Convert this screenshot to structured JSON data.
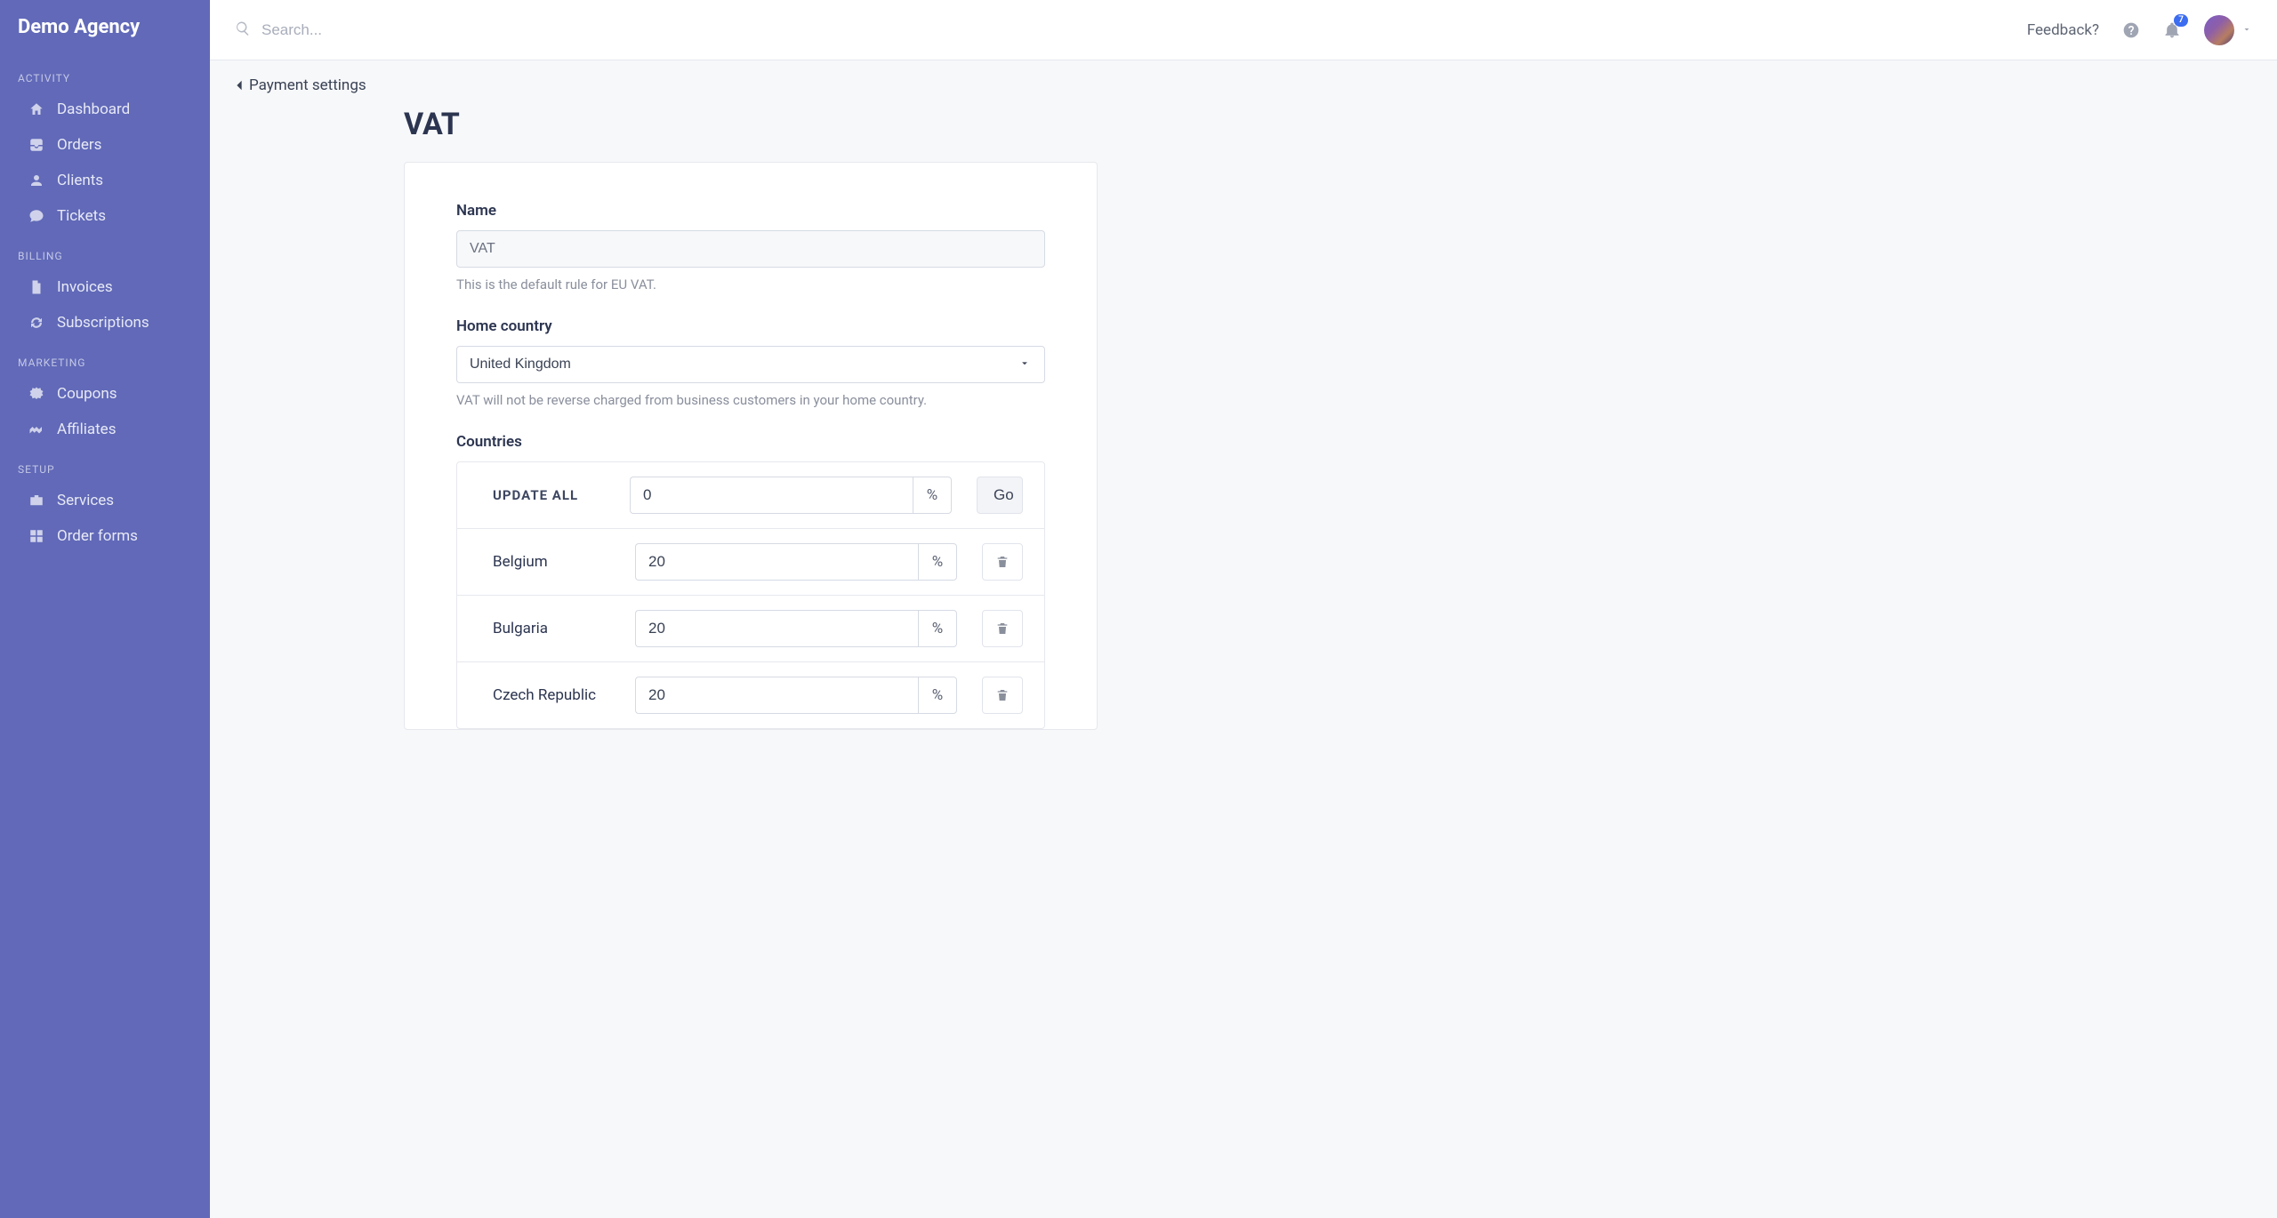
{
  "brand": "Demo Agency",
  "topbar": {
    "search_placeholder": "Search...",
    "feedback_label": "Feedback?",
    "notification_count": "7"
  },
  "sidebar": {
    "sections": [
      {
        "title": "ACTIVITY",
        "items": [
          {
            "label": "Dashboard",
            "icon": "home-icon"
          },
          {
            "label": "Orders",
            "icon": "inbox-in-icon"
          },
          {
            "label": "Clients",
            "icon": "user-icon"
          },
          {
            "label": "Tickets",
            "icon": "comment-icon"
          }
        ]
      },
      {
        "title": "BILLING",
        "items": [
          {
            "label": "Invoices",
            "icon": "file-icon"
          },
          {
            "label": "Subscriptions",
            "icon": "sync-icon"
          }
        ]
      },
      {
        "title": "MARKETING",
        "items": [
          {
            "label": "Coupons",
            "icon": "badge-icon"
          },
          {
            "label": "Affiliates",
            "icon": "handshake-icon"
          }
        ]
      },
      {
        "title": "SETUP",
        "items": [
          {
            "label": "Services",
            "icon": "briefcase-icon"
          },
          {
            "label": "Order forms",
            "icon": "grid-icon"
          }
        ]
      }
    ]
  },
  "breadcrumb": {
    "back_label": "Payment settings"
  },
  "page": {
    "title": "VAT",
    "name_label": "Name",
    "name_value": "VAT",
    "name_helper": "This is the default rule for EU VAT.",
    "home_country_label": "Home country",
    "home_country_value": "United Kingdom",
    "home_country_helper": "VAT will not be reverse charged from business customers in your home country.",
    "countries_label": "Countries",
    "update_all_label": "UPDATE ALL",
    "update_all_value": "0",
    "percent_symbol": "%",
    "go_label": "Go",
    "rows": [
      {
        "country": "Belgium",
        "rate": "20"
      },
      {
        "country": "Bulgaria",
        "rate": "20"
      },
      {
        "country": "Czech Republic",
        "rate": "20"
      }
    ]
  }
}
